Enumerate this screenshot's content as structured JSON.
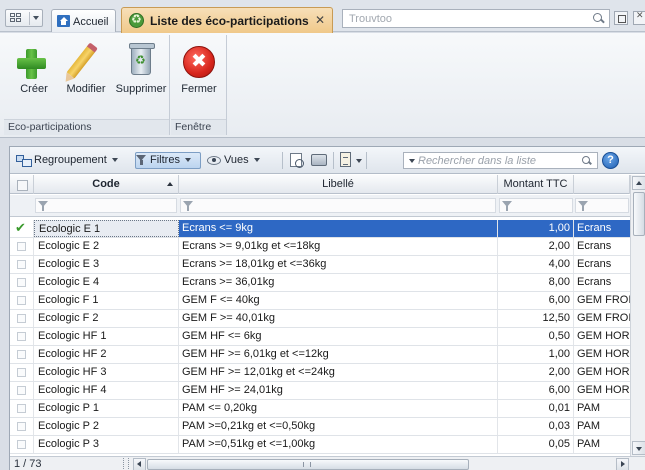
{
  "topbar": {
    "home_tab_label": "Accueil",
    "active_tab_label": "Liste des éco-participations",
    "search_placeholder": "Trouvtoo"
  },
  "ribbon": {
    "groups": [
      {
        "label": "Eco-participations",
        "buttons": [
          {
            "label": "Créer",
            "icon": "plus-icon"
          },
          {
            "label": "Modifier",
            "icon": "pencil-icon"
          },
          {
            "label": "Supprimer",
            "icon": "recycle-bin-icon"
          }
        ]
      },
      {
        "label": "Fenêtre",
        "buttons": [
          {
            "label": "Fermer",
            "icon": "close-circle-icon"
          }
        ]
      }
    ]
  },
  "toolbar": {
    "group_by_label": "Regroupement",
    "filters_label": "Filtres",
    "views_label": "Vues",
    "search_placeholder": "Rechercher dans la liste",
    "help_label": "?"
  },
  "table": {
    "columns": [
      "Code",
      "Libellé",
      "Montant TTC",
      ""
    ],
    "rows": [
      {
        "code": "Ecologic E 1",
        "libelle": "Ecrans <= 9kg",
        "montant": "1,00",
        "cat": "Ecrans",
        "selected": true
      },
      {
        "code": "Ecologic E 2",
        "libelle": "Ecrans >= 9,01kg et <=18kg",
        "montant": "2,00",
        "cat": "Ecrans"
      },
      {
        "code": "Ecologic E 3",
        "libelle": "Ecrans >= 18,01kg et <=36kg",
        "montant": "4,00",
        "cat": "Ecrans"
      },
      {
        "code": "Ecologic E 4",
        "libelle": "Ecrans >= 36,01kg",
        "montant": "8,00",
        "cat": "Ecrans"
      },
      {
        "code": "Ecologic F 1",
        "libelle": "GEM F <= 40kg",
        "montant": "6,00",
        "cat": "GEM FROID"
      },
      {
        "code": "Ecologic F 2",
        "libelle": "GEM F >= 40,01kg",
        "montant": "12,50",
        "cat": "GEM FROID"
      },
      {
        "code": "Ecologic HF 1",
        "libelle": "GEM HF <= 6kg",
        "montant": "0,50",
        "cat": "GEM HORS"
      },
      {
        "code": "Ecologic HF 2",
        "libelle": "GEM HF >= 6,01kg et <=12kg",
        "montant": "1,00",
        "cat": "GEM HORS"
      },
      {
        "code": "Ecologic HF 3",
        "libelle": "GEM HF >= 12,01kg et <=24kg",
        "montant": "2,00",
        "cat": "GEM HORS"
      },
      {
        "code": "Ecologic HF 4",
        "libelle": "GEM HF >= 24,01kg",
        "montant": "6,00",
        "cat": "GEM HORS"
      },
      {
        "code": "Ecologic P 1",
        "libelle": "PAM <= 0,20kg",
        "montant": "0,01",
        "cat": "PAM"
      },
      {
        "code": "Ecologic P 2",
        "libelle": "PAM >=0,21kg et <=0,50kg",
        "montant": "0,03",
        "cat": "PAM"
      },
      {
        "code": "Ecologic P 3",
        "libelle": "PAM >=0,51kg et <=1,00kg",
        "montant": "0,05",
        "cat": "PAM"
      }
    ]
  },
  "status": {
    "record_count": "1 / 73"
  },
  "colors": {
    "active_tab": "#f0c98a",
    "selection": "#2e68c4"
  }
}
